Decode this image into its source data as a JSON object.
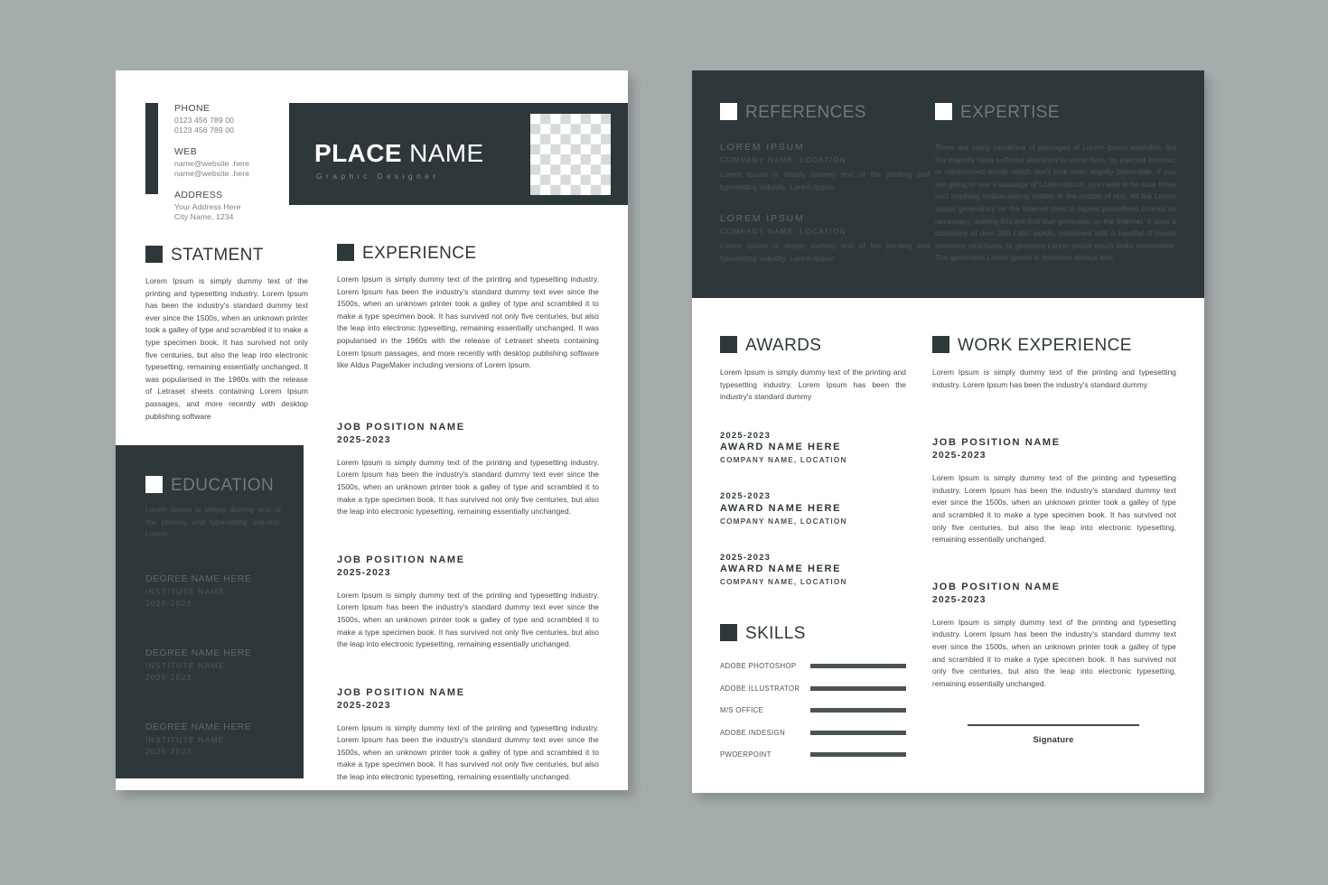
{
  "theme": {
    "dark": "#2e3739",
    "page_bg": "#a5acac",
    "paper": "#ffffff",
    "muted": "#7b8385"
  },
  "page1": {
    "contact": {
      "phone": {
        "label": "PHONE",
        "lines": [
          "0123 456 789 00",
          "0123 456 789 00"
        ]
      },
      "web": {
        "label": "WEB",
        "lines": [
          "name@website .here",
          "name@website .here"
        ]
      },
      "address": {
        "label": "ADDRESS",
        "lines": [
          "Your Address Here",
          "City Name, 1234"
        ]
      }
    },
    "name_block": {
      "first": "PLACE",
      "last": " NAME",
      "role": "Graphic Designer",
      "photo_placeholder": "photo-placeholder"
    },
    "statement": {
      "heading": "STATMENT",
      "body": "Lorem Ipsum is simply dummy text of the printing and typesetting industry. Lorem Ipsum has been the industry's standard dummy text ever since the 1500s, when an unknown printer took a galley of type and scrambled it to make a type specimen book. It has survived not only five centuries, but also the leap into electronic typesetting, remaining essentially unchanged. It was popularised in the 1960s with the release of Letraset sheets containing Lorem Ipsum passages, and more recently with desktop publishing software"
    },
    "education": {
      "heading": "EDUCATION",
      "intro": "Lorem Ipsum is simply dummy text of the printing and typesetting industry. Lorem",
      "items": [
        {
          "degree": "DEGREE NAME HERE",
          "institute": "INSTITUTE NAME",
          "years": "2025-2023"
        },
        {
          "degree": "DEGREE NAME HERE",
          "institute": "INSTITUTE NAME",
          "years": "2025-2023"
        },
        {
          "degree": "DEGREE NAME HERE",
          "institute": "INSTITUTE NAME",
          "years": "2025-2023"
        }
      ]
    },
    "experience": {
      "heading": "EXPERIENCE",
      "intro": "Lorem Ipsum is simply dummy text of the printing and typesetting industry. Lorem Ipsum has been the industry's standard dummy text ever since the 1500s, when an unknown printer took a galley of type and scrambled it to make a type specimen book. It has survived not only five centuries, but also the leap into electronic typesetting, remaining essentially unchanged. It was popularised in the 1960s with the release of Letraset sheets containing Lorem Ipsum passages, and more recently with desktop publishing software like Aldus PageMaker including versions of Lorem Ipsum.",
      "jobs": [
        {
          "title": "JOB POSITION NAME",
          "years": "2025-2023",
          "body": "Lorem Ipsum is simply dummy text of the printing and typesetting industry. Lorem Ipsum has been the industry's standard dummy text ever since the 1500s, when an unknown printer took a galley of type and scrambled it to make a type specimen book. It has survived not only five centuries, but also the leap into electronic typesetting, remaining essentially unchanged."
        },
        {
          "title": "JOB POSITION NAME",
          "years": "2025-2023",
          "body": "Lorem Ipsum is simply dummy text of the printing and typesetting industry. Lorem Ipsum has been the industry's standard dummy text ever since the 1500s, when an unknown printer took a galley of type and scrambled it to make a type specimen book. It has survived not only five centuries, but also the leap into electronic typesetting, remaining essentially unchanged."
        },
        {
          "title": "JOB POSITION NAME",
          "years": "2025-2023",
          "body": "Lorem Ipsum is simply dummy text of the printing and typesetting industry. Lorem Ipsum has been the industry's standard dummy text ever since the 1500s, when an unknown printer took a galley of type and scrambled it to make a type specimen book. It has survived not only five centuries, but also the leap into electronic typesetting, remaining essentially unchanged."
        }
      ]
    }
  },
  "page2": {
    "references": {
      "heading": "REFERENCES",
      "items": [
        {
          "name": "LOREM IPSUM",
          "company": "COMPANY NAME, LOCATION",
          "body": "Lorem Ipsum is simply dummy text of the printing and typesetting industry. Lorem Ipsum"
        },
        {
          "name": "LOREM IPSUM",
          "company": "COMPANY NAME, LOCATION",
          "body": "Lorem Ipsum is simply dummy text of the printing and typesetting industry. Lorem Ipsum"
        }
      ]
    },
    "expertise": {
      "heading": "EXPERTISE",
      "body": "There are many variations of passages of Lorem Ipsum available, but the majority have suffered alteration in some form, by injected humour, or randomised words which don't look even slightly believable. If you are going to use a passage of Lorem Ipsum, you need to be sure there isn't anything embarrassing hidden in the middle of text. All the Lorem Ipsum generators on the Internet tend to repeat predefined chunks as necessary, making this the first true generator on the Internet. It uses a dictionary of over 200 Latin words, combined with a handful of model sentence structures, to generate Lorem Ipsum which looks reasonable. The generated Lorem Ipsum is therefore always free"
    },
    "awards": {
      "heading": "AWARDS",
      "intro": "Lorem Ipsum is simply dummy text of the printing and typesetting industry. Lorem Ipsum has been the industry's standard dummy",
      "items": [
        {
          "years": "2025-2023",
          "name": "AWARD NAME HERE",
          "company": "COMPANY NAME, LOCATION"
        },
        {
          "years": "2025-2023",
          "name": "AWARD NAME HERE",
          "company": "COMPANY NAME, LOCATION"
        },
        {
          "years": "2025-2023",
          "name": "AWARD NAME HERE",
          "company": "COMPANY NAME, LOCATION"
        }
      ]
    },
    "skills": {
      "heading": "SKILLS",
      "items": [
        {
          "label": "ADOBE PHOTOSHOP",
          "percent": 100
        },
        {
          "label": "ADOBE ILLUSTRATOR",
          "percent": 100
        },
        {
          "label": "M/S OFFICE",
          "percent": 100
        },
        {
          "label": "ADOBE INDESIGN",
          "percent": 100
        },
        {
          "label": "PWOERPOINT",
          "percent": 100
        }
      ]
    },
    "work_experience": {
      "heading": "WORK EXPERIENCE",
      "intro": "Lorem Ipsum is simply dummy text of the printing and typesetting industry. Lorem Ipsum has been the industry's standard dummy",
      "jobs": [
        {
          "title": "JOB POSITION NAME",
          "years": "2025-2023",
          "body": "Lorem Ipsum is simply dummy text of the printing and typesetting industry. Lorem Ipsum has been the industry's standard dummy text ever since the 1500s, when an unknown printer took a galley of type and scrambled it to make a type specimen book. It has survived not only five centuries, but also the leap into electronic typesetting, remaining essentially unchanged."
        },
        {
          "title": "JOB POSITION NAME",
          "years": "2025-2023",
          "body": "Lorem Ipsum is simply dummy text of the printing and typesetting industry. Lorem Ipsum has been the industry's standard dummy text ever since the 1500s, when an unknown printer took a galley of type and scrambled it to make a type specimen book. It has survived not only five centuries, but also the leap into electronic typesetting, remaining essentially unchanged."
        }
      ]
    },
    "signature": {
      "label": "Signature"
    }
  }
}
